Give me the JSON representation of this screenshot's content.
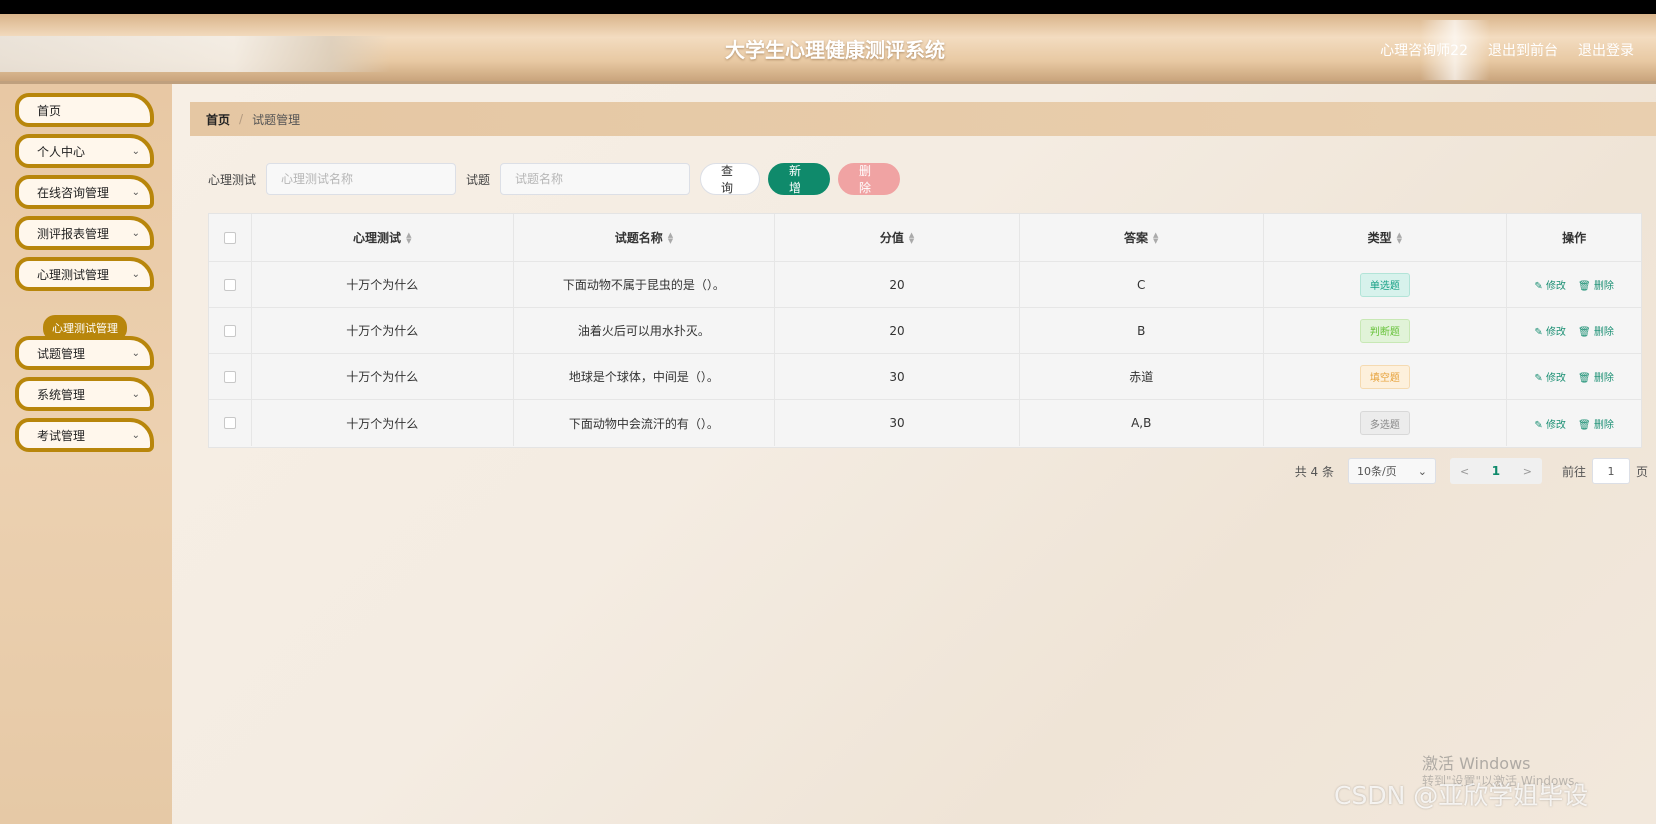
{
  "header": {
    "title": "大学生心理健康测评系统",
    "user": "心理咨询师22",
    "to_front": "退出到前台",
    "logout": "退出登录"
  },
  "sidebar": {
    "items": [
      {
        "label": "首页"
      },
      {
        "label": "个人中心"
      },
      {
        "label": "在线咨询管理"
      },
      {
        "label": "测评报表管理"
      },
      {
        "label": "心理测试管理"
      },
      {
        "label": "试题管理"
      },
      {
        "label": "系统管理"
      },
      {
        "label": "考试管理"
      }
    ],
    "submenu_label": "心理测试管理"
  },
  "breadcrumb": {
    "home": "首页",
    "sep": "/",
    "current": "试题管理"
  },
  "search": {
    "test_label": "心理测试",
    "test_placeholder": "心理测试名称",
    "question_label": "试题",
    "question_placeholder": "试题名称",
    "query": "查询",
    "add": "新增",
    "delete": "删除"
  },
  "table": {
    "headers": [
      "心理测试",
      "试题名称",
      "分值",
      "答案",
      "类型",
      "操作"
    ],
    "rows": [
      {
        "test": "十万个为什么",
        "question": "下面动物不属于昆虫的是（）。",
        "score": "20",
        "answer": "C",
        "type": "单选题"
      },
      {
        "test": "十万个为什么",
        "question": "油着火后可以用水扑灭。",
        "score": "20",
        "answer": "B",
        "type": "判断题"
      },
      {
        "test": "十万个为什么",
        "question": "地球是个球体，中间是（）。",
        "score": "30",
        "answer": "赤道",
        "type": "填空题"
      },
      {
        "test": "十万个为什么",
        "question": "下面动物中会流汗的有（）。",
        "score": "30",
        "answer": "A,B",
        "type": "多选题"
      }
    ],
    "edit": "修改",
    "remove": "删除"
  },
  "pager": {
    "total": "共 4 条",
    "size": "10条/页",
    "page": "1",
    "goto": "前往",
    "goto_value": "1",
    "page_suffix": "页"
  },
  "watermark": {
    "line1": "激活 Windows",
    "line2": "转到\"设置\"以激活 Windows。",
    "csdn": "CSDN @亚欣学姐毕设"
  },
  "colors": {
    "accent": "#0f8a6b",
    "menu_border": "#b8860b",
    "danger": "#f0a3a3"
  }
}
